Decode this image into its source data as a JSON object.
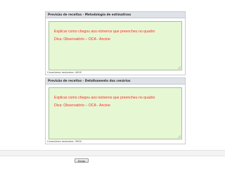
{
  "sections": [
    {
      "title": "Previsão de receitas - Metodologia de estimativas",
      "textarea_lines": [
        "Explicar como chegou aos números que preencheu no quadro",
        "Dica: Observatório – OCA - Ancine"
      ],
      "counter": "Caracteres restantes: 4000"
    },
    {
      "title": "Previsão de receitas - Detalhamento dos cenários",
      "textarea_lines": [
        "Explicar como chegou aos números que preencheu no quadro",
        "Dica: Observatório – OCA - Ancine"
      ],
      "counter": "Caracteres restantes: 3900"
    }
  ],
  "submit_label": "Enviar",
  "colors": {
    "textarea_background": "#e6f7d4",
    "hint_text": "#ff2a2a",
    "header_background": "#dfe3e8"
  }
}
